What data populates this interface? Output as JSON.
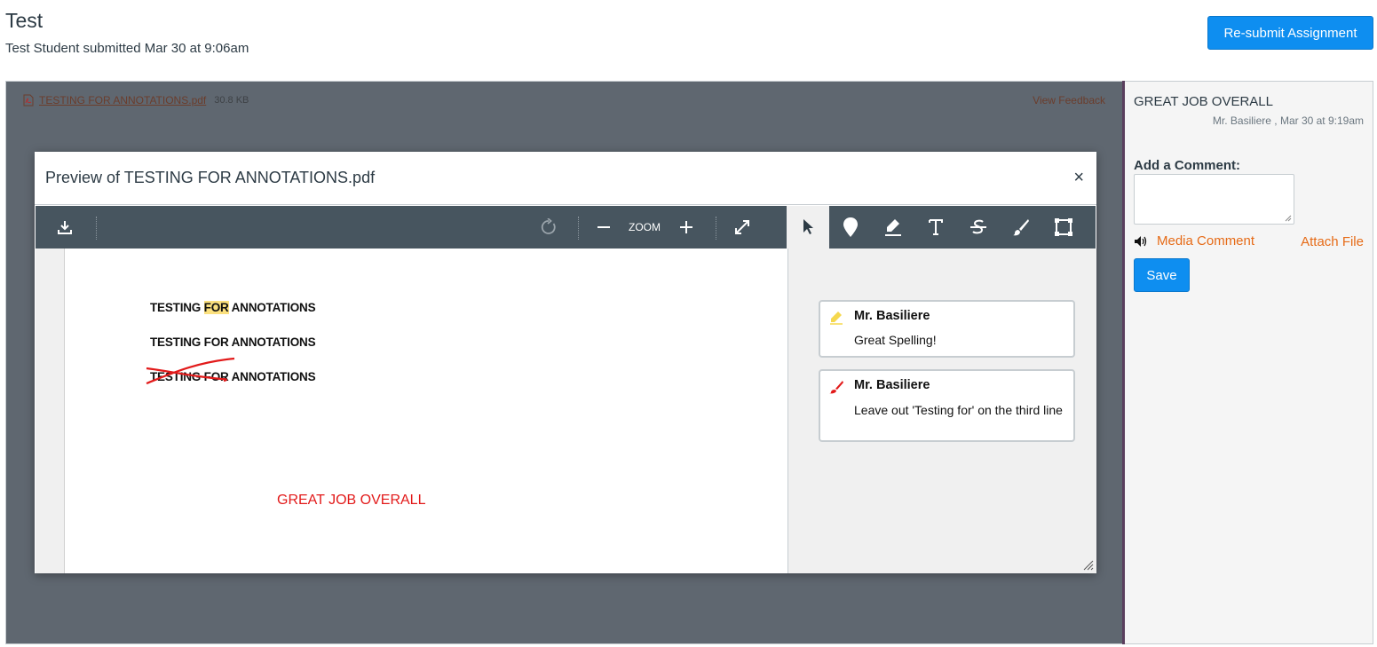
{
  "header": {
    "title": "Test",
    "submitted": "Test Student submitted Mar 30 at 9:06am",
    "resubmit_label": "Re-submit Assignment"
  },
  "file": {
    "name": "TESTING FOR ANNOTATIONS.pdf",
    "size": "30.8 KB",
    "view_feedback": "View Feedback"
  },
  "modal": {
    "title": "Preview of TESTING FOR ANNOTATIONS.pdf",
    "close": "×",
    "zoom_label": "ZOOM"
  },
  "document": {
    "line1_a": "TESTING ",
    "line1_b": "FOR",
    "line1_c": " ANNOTATIONS",
    "line2": "TESTING FOR ANNOTATIONS",
    "line3": "TESTING FOR ANNOTATIONS",
    "great_job": "GREAT JOB OVERALL"
  },
  "annotations": [
    {
      "author": "Mr. Basiliere",
      "text": "Great Spelling!",
      "icon": "highlighter-icon",
      "icon_color": "#f5d84e"
    },
    {
      "author": "Mr. Basiliere",
      "text": "Leave out 'Testing for' on the third line",
      "icon": "freehand-icon",
      "icon_color": "#e21a1a"
    }
  ],
  "sidebar": {
    "comment_title": "GREAT JOB OVERALL",
    "comment_meta": "Mr. Basiliere , Mar 30 at 9:19am",
    "add_comment_label": "Add a Comment:",
    "media_comment": "Media Comment",
    "attach_file": "Attach File",
    "save_label": "Save"
  },
  "colors": {
    "primary_button": "#0e8ef0",
    "link_orange": "#e66b17",
    "toolbar": "#47555f",
    "highlight": "#fbe07e",
    "annotation_red": "#e21a1a"
  }
}
